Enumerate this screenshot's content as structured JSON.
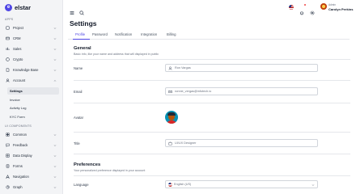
{
  "app": {
    "logo_letter": "e",
    "name": "elstar"
  },
  "sidebar": {
    "section_apps": "APPS",
    "section_ui": "UI COMPONENTS",
    "apps_items": [
      {
        "label": "Project",
        "icon": "project-icon"
      },
      {
        "label": "CRM",
        "icon": "crm-icon"
      },
      {
        "label": "Sales",
        "icon": "sales-icon"
      },
      {
        "label": "Crypto",
        "icon": "crypto-icon"
      },
      {
        "label": "Knowledge Base",
        "icon": "knowledge-icon"
      },
      {
        "label": "Account",
        "icon": "account-icon"
      }
    ],
    "account_sub": [
      {
        "label": "Settings",
        "active": true
      },
      {
        "label": "Invoice",
        "active": false
      },
      {
        "label": "Activity Log",
        "active": false
      },
      {
        "label": "KYC Form",
        "active": false
      }
    ],
    "ui_items": [
      {
        "label": "Common",
        "icon": "common-icon"
      },
      {
        "label": "Feedback",
        "icon": "feedback-icon"
      },
      {
        "label": "Data Display",
        "icon": "data-display-icon"
      },
      {
        "label": "Forms",
        "icon": "forms-icon"
      },
      {
        "label": "Navigation",
        "icon": "navigation-icon"
      },
      {
        "label": "Graph",
        "icon": "graph-icon"
      }
    ]
  },
  "topbar": {
    "user_role": "Admin",
    "user_name": "Carolyn Perkins"
  },
  "page": {
    "title": "Settings"
  },
  "tabs": [
    "Profile",
    "Password",
    "Notification",
    "Integration",
    "Billing"
  ],
  "general": {
    "title": "General",
    "description": "Basic info, like your name and address that will displayed in public",
    "name_label": "Name",
    "name_value": "Ron Vargas",
    "email_label": "Email",
    "email_value": "ronnie_vergas@infotech.io",
    "avatar_label": "Avatar",
    "title_label": "Title",
    "title_value": "UI/UX Designer"
  },
  "preferences": {
    "title": "Preferences",
    "description": "Your personalized preference displayed in your account",
    "language_label": "Language",
    "language_value": "English (US)"
  },
  "colors": {
    "accent": "#4f46e5",
    "sidebar_bg": "#f3f4f6",
    "text": "#111827"
  }
}
